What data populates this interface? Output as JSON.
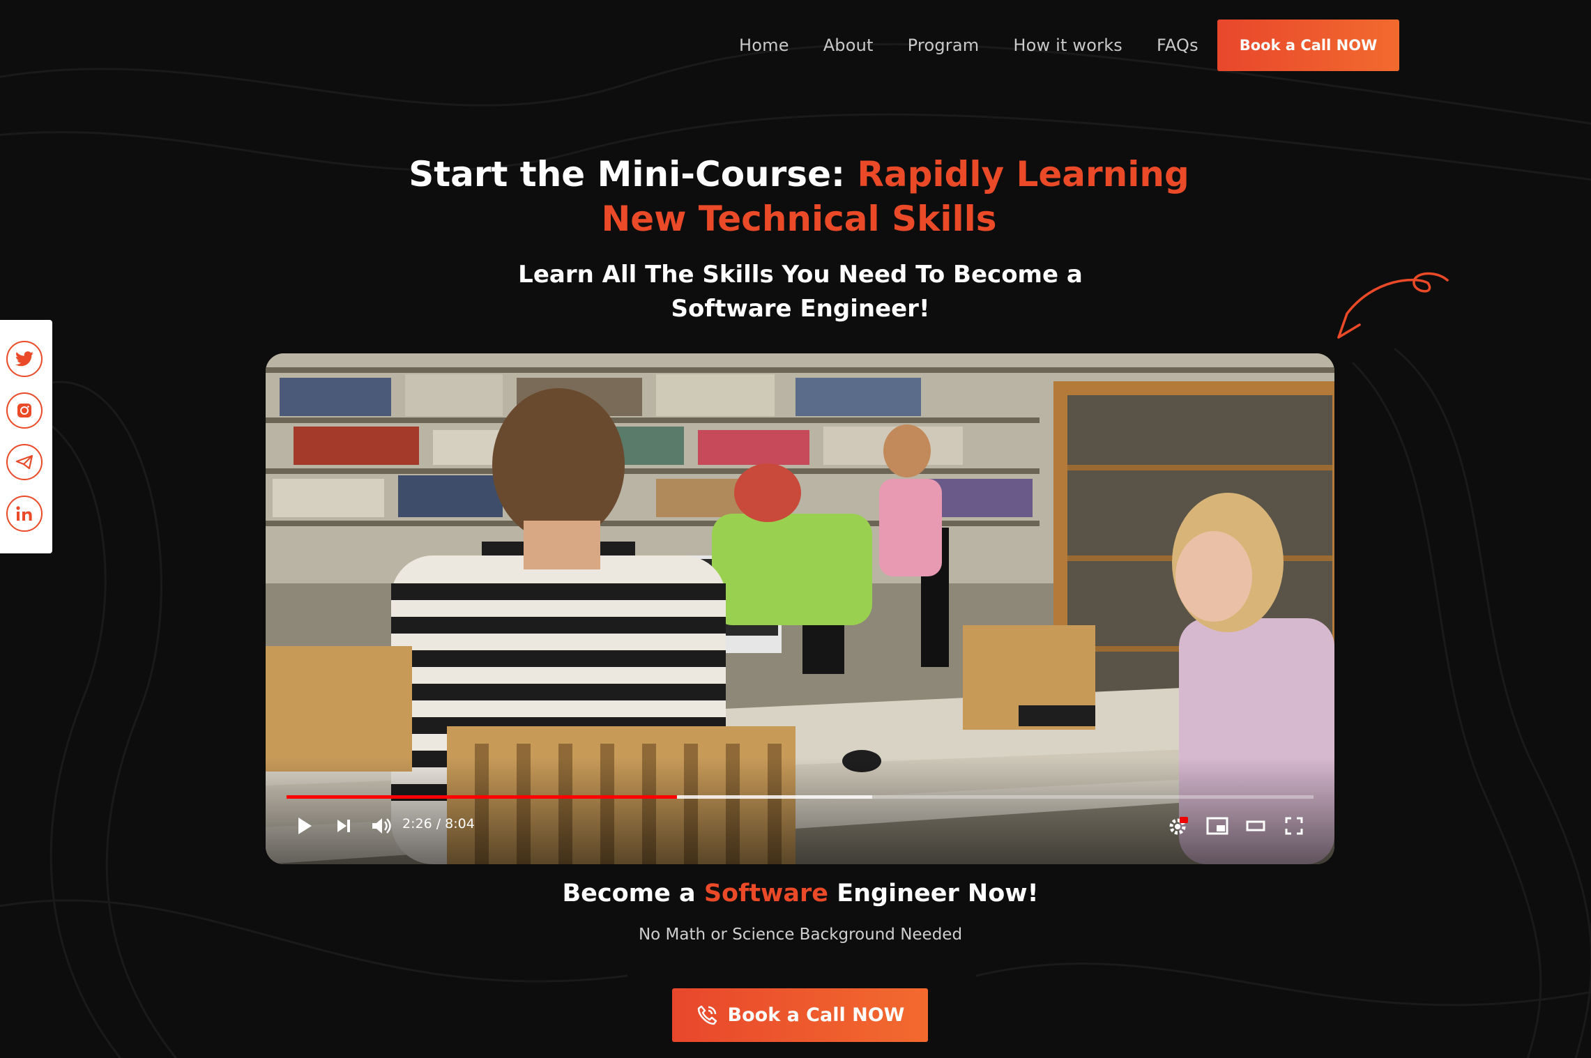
{
  "nav": {
    "items": [
      {
        "label": "Home"
      },
      {
        "label": "About"
      },
      {
        "label": "Program"
      },
      {
        "label": "How it works"
      },
      {
        "label": "FAQs"
      }
    ],
    "cta_label": "Book a Call NOW"
  },
  "hero": {
    "title_plain": "Start the Mini-Course: ",
    "title_accent": "Rapidly Learning New Technical Skills",
    "subtitle": "Learn All The Skills You Need To Become a Software Engineer!"
  },
  "social": {
    "icons": [
      "twitter-icon",
      "instagram-icon",
      "telegram-icon",
      "linkedin-icon"
    ]
  },
  "video": {
    "time_display": "2:26 / 8:04",
    "played_fraction": 0.38,
    "buffered_fraction": 0.57,
    "controls": [
      "play-icon",
      "next-icon",
      "volume-icon",
      "settings-icon",
      "miniplayer-icon",
      "theater-icon",
      "fullscreen-icon"
    ]
  },
  "cta": {
    "heading_pre": "Become a ",
    "heading_accent": "Software",
    "heading_post": " Engineer Now!",
    "note": "No Math or Science Background Needed",
    "button_label": "Book a Call NOW"
  },
  "colors": {
    "accent": "#ea4a28",
    "background": "#0d0d0d",
    "progress": "#ff0000"
  }
}
